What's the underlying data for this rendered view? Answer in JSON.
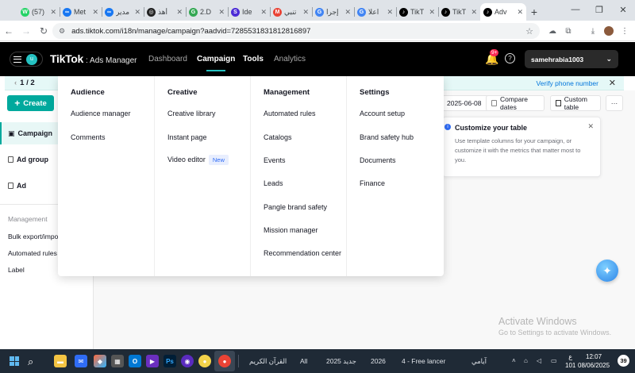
{
  "browser": {
    "tabs": [
      {
        "label": "(57)",
        "fav_color": "#25d366",
        "fav_glyph": "W"
      },
      {
        "label": "Met",
        "fav_color": "#1877f2",
        "fav_glyph": "∞"
      },
      {
        "label": "مدير",
        "fav_color": "#1877f2",
        "fav_glyph": "∞"
      },
      {
        "label": "أهذ",
        "fav_color": "#222222",
        "fav_glyph": "◎"
      },
      {
        "label": "2.D",
        "fav_color": "#34a853",
        "fav_glyph": "G"
      },
      {
        "label": "Ide",
        "fav_color": "#4b2bd6",
        "fav_glyph": "S"
      },
      {
        "label": "تنبي",
        "fav_color": "#ea4335",
        "fav_glyph": "M"
      },
      {
        "label": "إجرا",
        "fav_color": "#4285f4",
        "fav_glyph": "G"
      },
      {
        "label": "اعلا",
        "fav_color": "#4285f4",
        "fav_glyph": "G"
      },
      {
        "label": "TikT",
        "fav_color": "#000000",
        "fav_glyph": "♪"
      },
      {
        "label": "TikT",
        "fav_color": "#000000",
        "fav_glyph": "♪"
      },
      {
        "label": "Adv",
        "fav_color": "#000000",
        "fav_glyph": "♪",
        "active": true
      }
    ],
    "url": "ads.tiktok.com/i18n/manage/campaign?aadvid=7285531831812816897"
  },
  "header": {
    "avatar_letter": "u",
    "logo": "TikTok",
    "logo_suffix": ": Ads Manager",
    "nav": [
      "Dashboard",
      "Campaign",
      "Tools",
      "Analytics"
    ],
    "notification_count": "9+",
    "account": "samehrabia1003"
  },
  "notice": {
    "pager": "1 / 2",
    "verify_link": "Verify phone number"
  },
  "sidebar": {
    "create_label": "Create",
    "levels": [
      "Campaign",
      "Ad group",
      "Ad"
    ],
    "section_header": "Management",
    "items": [
      "Bulk export/impo",
      "Automated rules",
      "Label"
    ]
  },
  "toolbar": {
    "date": "2025-06-08",
    "compare": "Compare dates",
    "custom_table": "Custom table",
    "more": "···"
  },
  "tip": {
    "title": "Customize your table",
    "body": "Use template columns for your campaign, or customize it with the metrics that matter most to you."
  },
  "tools_menu": {
    "columns": [
      {
        "header": "Audience",
        "items": [
          "Audience manager",
          "Comments"
        ]
      },
      {
        "header": "Creative",
        "items": [
          "Creative library",
          "Instant page",
          "Video editor"
        ],
        "new_tag": "New"
      },
      {
        "header": "Management",
        "items": [
          "Automated rules",
          "Catalogs",
          "Events",
          "Leads",
          "Pangle brand safety",
          "Mission manager",
          "Recommendation center"
        ]
      },
      {
        "header": "Settings",
        "items": [
          "Account setup",
          "Brand safety hub",
          "Documents",
          "Finance"
        ]
      }
    ]
  },
  "watermark": {
    "line1": "Activate Windows",
    "line2": "Go to Settings to activate Windows."
  },
  "taskbar": {
    "items": [
      "القرآن الكريم",
      "All",
      "2025 جديد",
      "2026",
      "4 - Free lancer",
      "آيامي"
    ],
    "tray_lang": "ع",
    "tray_num": "101",
    "time": "12:07",
    "date": "08/06/2025",
    "notif": "39"
  }
}
